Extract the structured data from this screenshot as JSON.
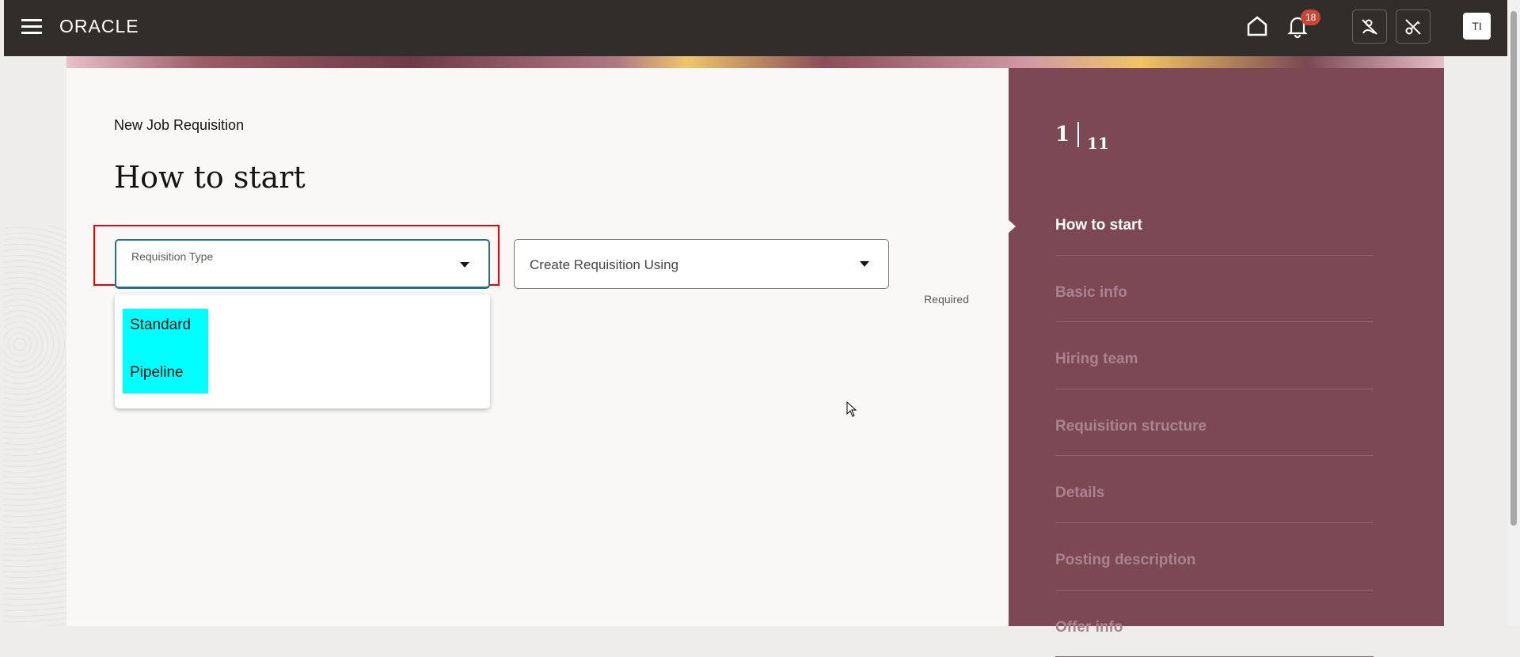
{
  "header": {
    "logo": "ORACLE",
    "notification_count": "18",
    "avatar_initials": "TI"
  },
  "page": {
    "subtitle": "New Job Requisition",
    "title": "How to start"
  },
  "form": {
    "requisition_type": {
      "label": "Requisition Type",
      "options": [
        "Standard",
        "Pipeline"
      ]
    },
    "create_using": {
      "placeholder": "Create Requisition Using",
      "helper": "Required"
    }
  },
  "progress": {
    "current": "1",
    "total": "11"
  },
  "steps": [
    "How to start",
    "Basic info",
    "Hiring team",
    "Requisition structure",
    "Details",
    "Posting description",
    "Offer info"
  ],
  "colors": {
    "topbar": "#312d2a",
    "panel": "#7b4853",
    "highlight": "#00ffff",
    "badge": "#c74634"
  }
}
